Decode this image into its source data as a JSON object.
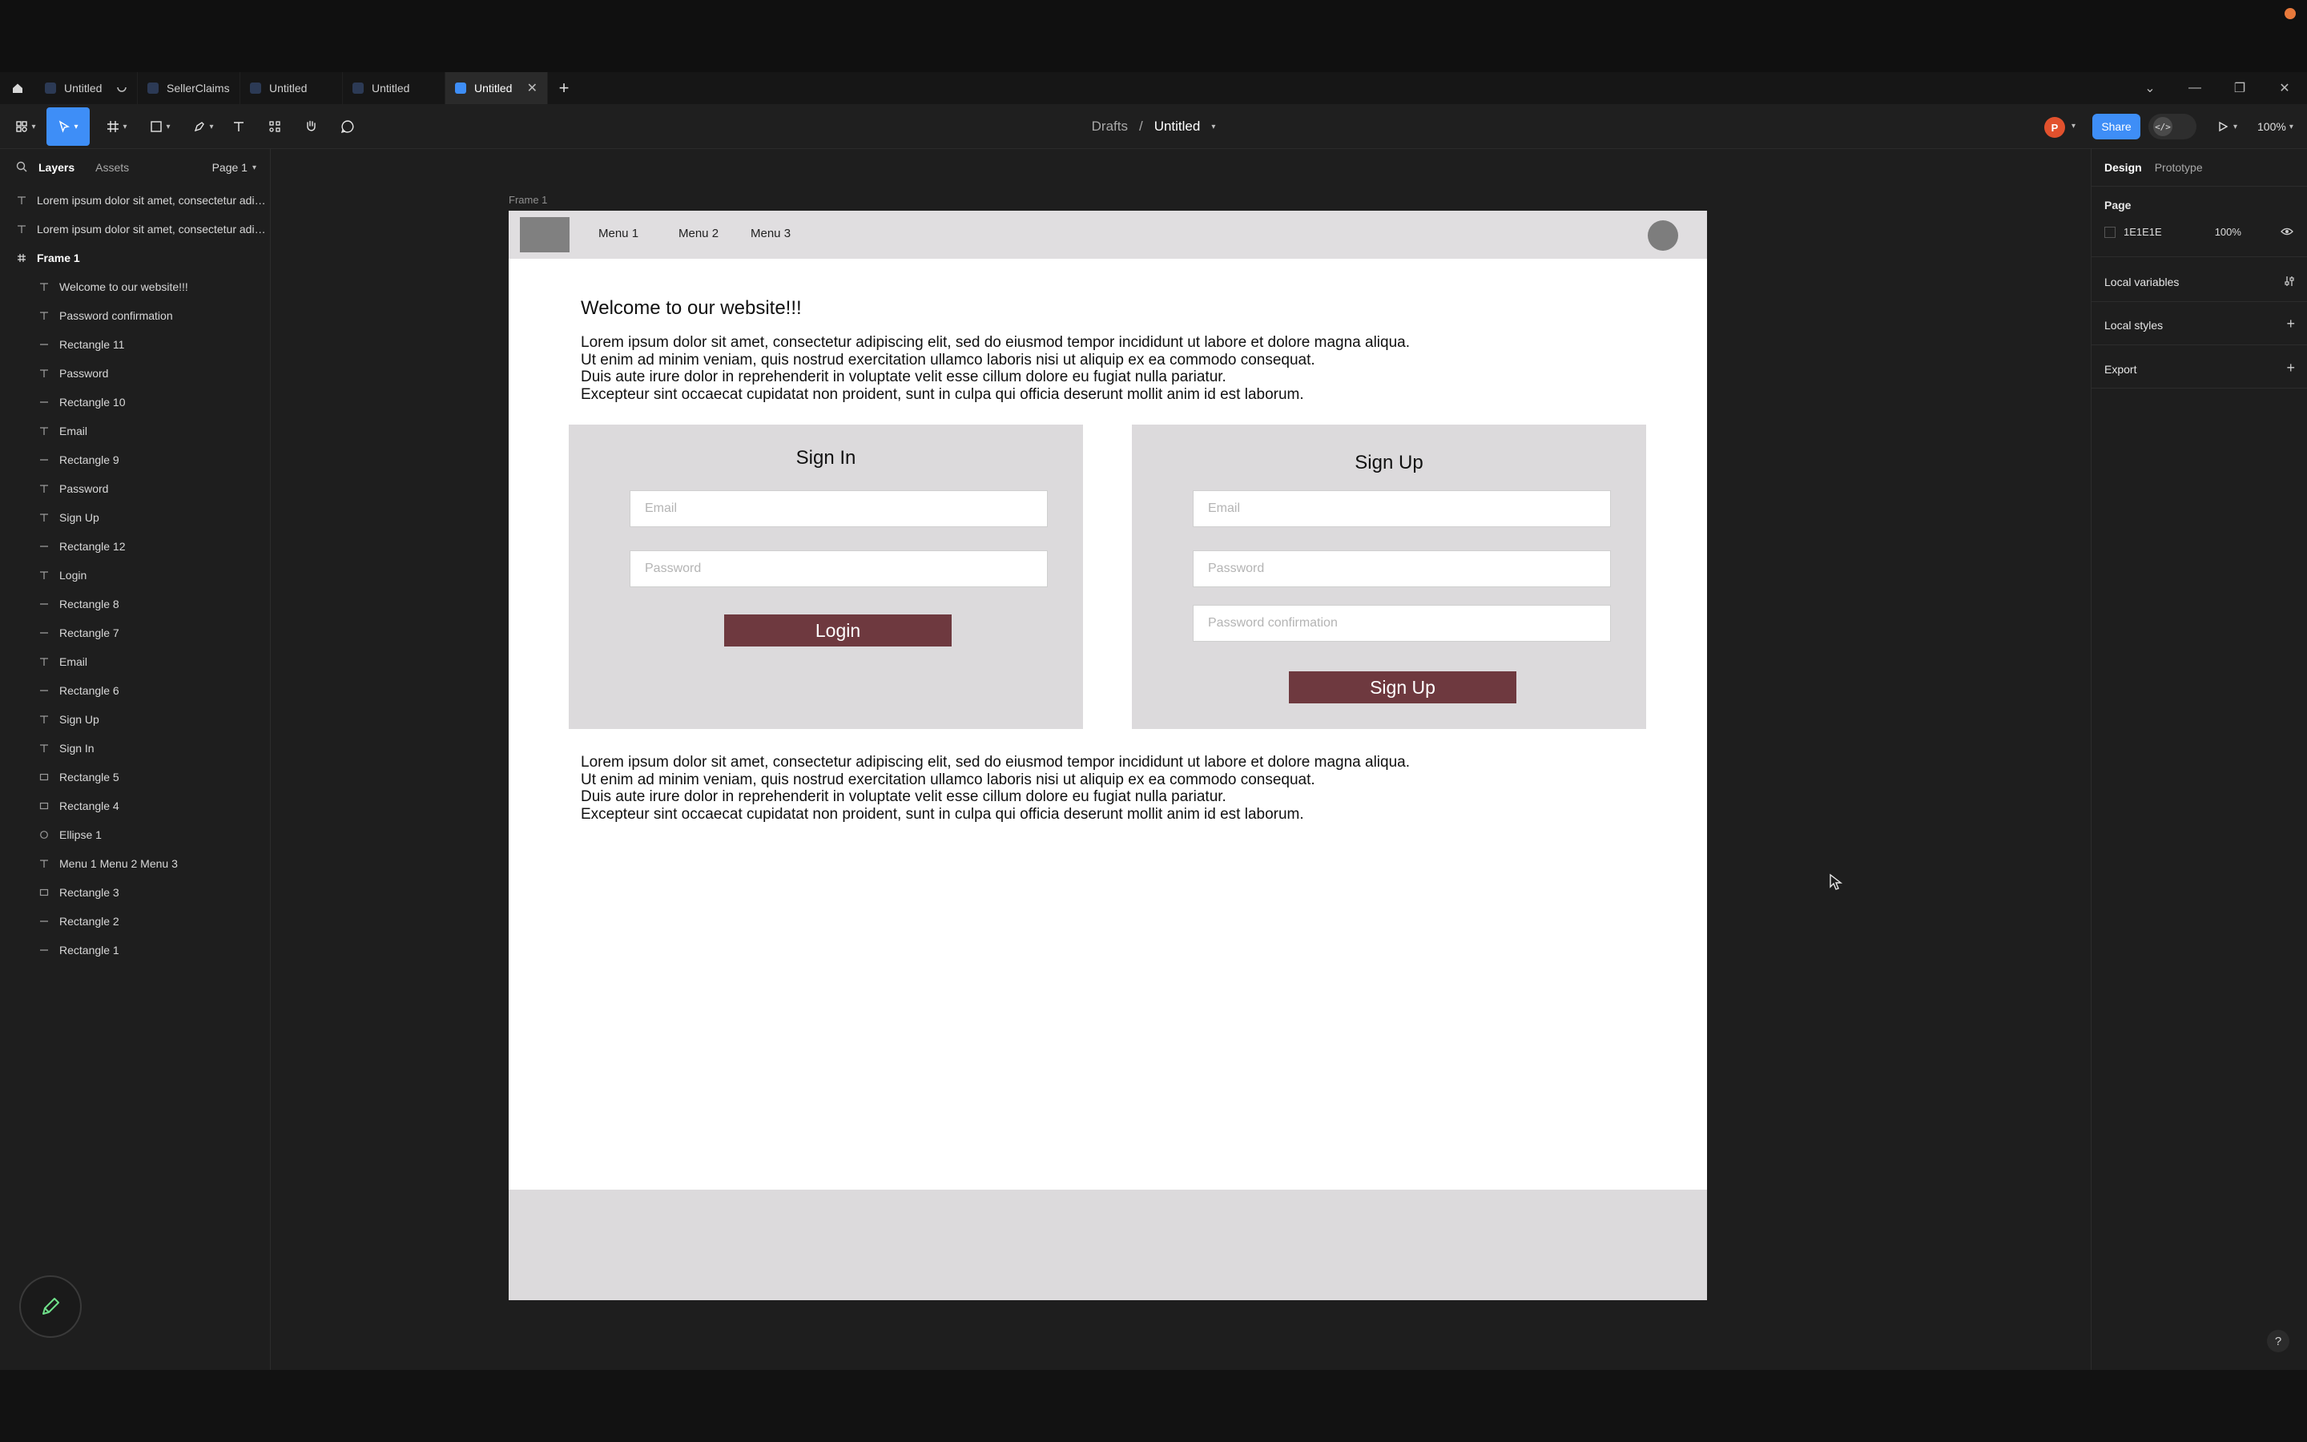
{
  "tabs": [
    {
      "label": "Untitled",
      "loading": true
    },
    {
      "label": "SellerClaims"
    },
    {
      "label": "Untitled"
    },
    {
      "label": "Untitled"
    },
    {
      "label": "Untitled",
      "active": true
    }
  ],
  "breadcrumb": {
    "parent": "Drafts",
    "separator": "/",
    "file": "Untitled"
  },
  "toolbar": {
    "avatar_initial": "P",
    "share_label": "Share",
    "zoom": "100%"
  },
  "left_panel": {
    "tabs": [
      "Layers",
      "Assets"
    ],
    "page_selector": "Page 1",
    "layers": [
      {
        "name": "Lorem ipsum dolor sit amet, consectetur adipi...",
        "type": "text",
        "indent": 0
      },
      {
        "name": "Lorem ipsum dolor sit amet, consectetur adipi...",
        "type": "text",
        "indent": 0
      },
      {
        "name": "Frame 1",
        "type": "frame",
        "indent": 0
      },
      {
        "name": "Welcome to our website!!!",
        "type": "text",
        "indent": 1
      },
      {
        "name": "Password confirmation",
        "type": "text",
        "indent": 1
      },
      {
        "name": "Rectangle 11",
        "type": "line",
        "indent": 1
      },
      {
        "name": "Password",
        "type": "text",
        "indent": 1
      },
      {
        "name": "Rectangle 10",
        "type": "line",
        "indent": 1
      },
      {
        "name": "Email",
        "type": "text",
        "indent": 1
      },
      {
        "name": "Rectangle 9",
        "type": "line",
        "indent": 1
      },
      {
        "name": "Password",
        "type": "text",
        "indent": 1
      },
      {
        "name": "Sign Up",
        "type": "text",
        "indent": 1
      },
      {
        "name": "Rectangle 12",
        "type": "line",
        "indent": 1
      },
      {
        "name": "Login",
        "type": "text",
        "indent": 1
      },
      {
        "name": "Rectangle 8",
        "type": "line",
        "indent": 1
      },
      {
        "name": "Rectangle 7",
        "type": "line",
        "indent": 1
      },
      {
        "name": "Email",
        "type": "text",
        "indent": 1
      },
      {
        "name": "Rectangle 6",
        "type": "line",
        "indent": 1
      },
      {
        "name": "Sign Up",
        "type": "text",
        "indent": 1
      },
      {
        "name": "Sign In",
        "type": "text",
        "indent": 1
      },
      {
        "name": "Rectangle 5",
        "type": "rect",
        "indent": 1
      },
      {
        "name": "Rectangle 4",
        "type": "rect",
        "indent": 1
      },
      {
        "name": "Ellipse 1",
        "type": "ellipse",
        "indent": 1
      },
      {
        "name": "Menu 1 Menu 2 Menu 3",
        "type": "text",
        "indent": 1
      },
      {
        "name": "Rectangle 3",
        "type": "rect",
        "indent": 1
      },
      {
        "name": "Rectangle 2",
        "type": "line",
        "indent": 1
      },
      {
        "name": "Rectangle 1",
        "type": "line",
        "indent": 1
      }
    ]
  },
  "canvas": {
    "frame_label": "Frame 1",
    "menu": [
      "Menu 1",
      "Menu 2",
      "Menu 3"
    ],
    "welcome": "Welcome to our website!!!",
    "paragraph_top": "Lorem ipsum dolor sit amet, consectetur adipiscing elit, sed do eiusmod tempor incididunt ut labore et dolore magna aliqua.\nUt enim ad minim veniam, quis nostrud exercitation ullamco laboris nisi ut aliquip ex ea commodo consequat.\nDuis aute irure dolor in reprehenderit in voluptate velit esse cillum dolore eu fugiat nulla pariatur.\nExcepteur sint occaecat cupidatat non proident, sunt in culpa qui officia deserunt mollit anim id est laborum.",
    "signin": {
      "title": "Sign In",
      "email_placeholder": "Email",
      "password_placeholder": "Password",
      "button": "Login"
    },
    "signup": {
      "title": "Sign Up",
      "email_placeholder": "Email",
      "password_placeholder": "Password",
      "confirm_placeholder": "Password confirmation",
      "button": "Sign Up"
    },
    "paragraph_bottom": "Lorem ipsum dolor sit amet, consectetur adipiscing elit, sed do eiusmod tempor incididunt ut labore et dolore magna aliqua.\nUt enim ad minim veniam, quis nostrud exercitation ullamco laboris nisi ut aliquip ex ea commodo consequat.\nDuis aute irure dolor in reprehenderit in voluptate velit esse cillum dolore eu fugiat nulla pariatur.\nExcepteur sint occaecat cupidatat non proident, sunt in culpa qui officia deserunt mollit anim id est laborum."
  },
  "right_panel": {
    "tabs": [
      "Design",
      "Prototype"
    ],
    "page_title": "Page",
    "page_color": "1E1E1E",
    "page_opacity": "100%",
    "local_variables": "Local variables",
    "local_styles": "Local styles",
    "export": "Export"
  },
  "colors": {
    "accent": "#3e8ef7",
    "button_fill": "#6e393f",
    "card_fill": "#dcdadc",
    "avatar": "#e2512d"
  }
}
